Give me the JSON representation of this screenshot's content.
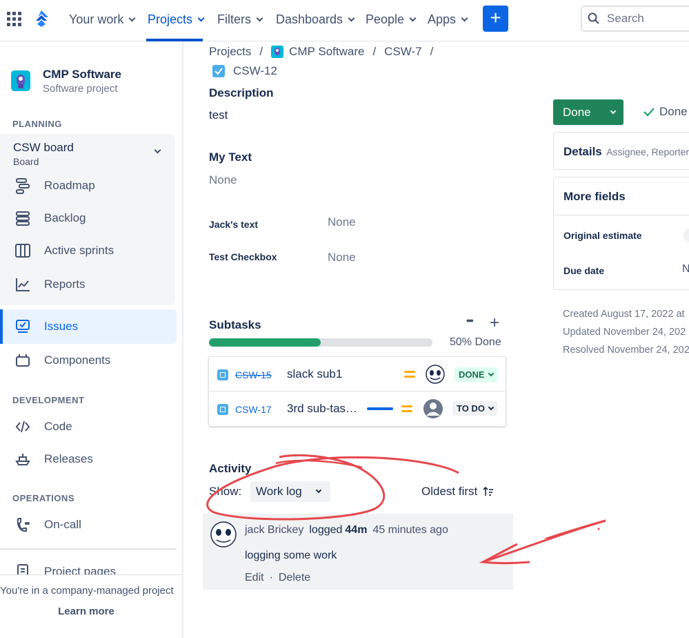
{
  "nav": {
    "items": [
      "Your work",
      "Projects",
      "Filters",
      "Dashboards",
      "People",
      "Apps"
    ],
    "create_label": "+",
    "search_placeholder": "Search"
  },
  "sidebar": {
    "project_name": "CMP Software",
    "project_type": "Software project",
    "planning_title": "PLANNING",
    "board_name": "CSW board",
    "board_sub": "Board",
    "planning_items": [
      "Roadmap",
      "Backlog",
      "Active sprints",
      "Reports"
    ],
    "issues": "Issues",
    "components": "Components",
    "development_title": "DEVELOPMENT",
    "dev_items": [
      "Code",
      "Releases"
    ],
    "operations_title": "OPERATIONS",
    "ops_items": [
      "On-call"
    ],
    "project_pages": "Project pages",
    "footer_text": "You're in a company-managed project",
    "learn_more": "Learn more"
  },
  "breadcrumb": {
    "projects": "Projects",
    "sep": "/",
    "project": "CMP Software",
    "parent": "CSW-7",
    "issue": "CSW-12"
  },
  "issue": {
    "description_label": "Description",
    "description": "test",
    "my_text_label": "My Text",
    "my_text": "None",
    "jacks_text_label": "Jack's text",
    "jacks_text": "None",
    "checkbox_label": "Test Checkbox",
    "checkbox_value": "None"
  },
  "subtasks": {
    "title": "Subtasks",
    "more": "•••",
    "add": "+",
    "progress": 0.5,
    "progress_text": "50% Done",
    "rows": [
      {
        "key": "CSW-15",
        "summary": "slack sub1",
        "status": "DONE"
      },
      {
        "key": "CSW-17",
        "summary": "3rd sub-tas…",
        "status": "TO DO"
      }
    ]
  },
  "activity": {
    "title": "Activity",
    "show_label": "Show:",
    "filter": "Work log",
    "sort": "Oldest first",
    "entry": {
      "author": "jack Brickey",
      "action": "logged",
      "amount": "44m",
      "time": "45 minutes ago",
      "comment": "logging some work",
      "edit": "Edit",
      "dot": "·",
      "delete": "Delete"
    }
  },
  "right": {
    "status_button": "Done",
    "resolution": "Done",
    "details_label": "Details",
    "details_sub": "Assignee, Reporter",
    "more_fields": "More fields",
    "original_estimate": "Original estimate",
    "due_date": "Due date",
    "due_date_value": "N",
    "created": "Created August 17, 2022 at",
    "updated": "Updated November 24, 202",
    "resolved": "Resolved November 24, 202"
  },
  "colors": {
    "accent": "#0052cc",
    "done_green": "#1f845a",
    "progress_green": "#22a06b",
    "annotation_red": "#e5484d"
  }
}
